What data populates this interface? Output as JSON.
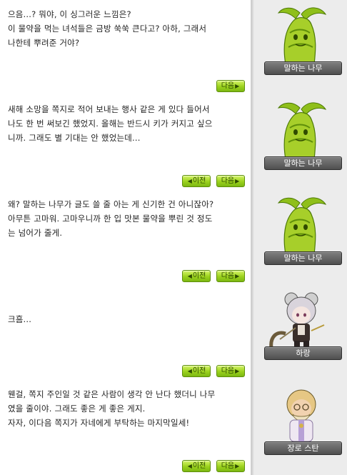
{
  "colors": {
    "button_green": "#9bd21d",
    "nameplate": "#5a5a5a",
    "sidebar": "#ececec"
  },
  "buttons": {
    "next_label": "다음",
    "prev_label": "이전"
  },
  "dialogs": [
    {
      "text": "으음...? 뭐야, 이 싱그러운 느낌은?\n이 물약을 먹는 녀석들은 금방 쑥쑥 큰다고? 아하, 그래서\n나한테 뿌려준 거야?",
      "speaker": "말하는 나무",
      "portrait": "talking-tree-icon"
    },
    {
      "text": "새해 소망을 쪽지로 적어 보내는 행사 같은 게 있다 들어서\n나도 한 번 써보긴 했었지. 올해는 반드시 키가 커지고 싶으\n니까. 그래도 별 기대는 안 했었는데...",
      "speaker": "말하는 나무",
      "portrait": "talking-tree-icon"
    },
    {
      "text": "왜? 말하는 나무가 글도 쓸 줄 아는 게 신기한 건 아니잖아?\n아무튼 고마워. 고마우니까 한 입 맛본 물약을 뿌린 것 정도\n는 넘어가 줄게.",
      "speaker": "말하는 나무",
      "portrait": "talking-tree-icon"
    },
    {
      "text": "크흠...",
      "speaker": "하랑",
      "portrait": "harang-icon"
    },
    {
      "text": "웬걸, 쪽지 주인일 것 같은 사람이 생각 안 난다 했더니 나무\n였을 줄이야. 그래도 좋은 게 좋은 게지.\n자자, 이다음 쪽지가 자네에게 부탁하는 마지막일세!",
      "speaker": "장로 스탄",
      "portrait": "elder-stan-icon"
    }
  ]
}
